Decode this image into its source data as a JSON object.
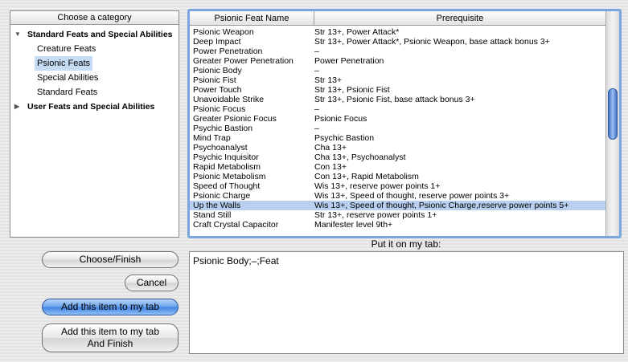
{
  "category_pane": {
    "header": "Choose a category",
    "items": [
      {
        "label": "Standard Feats and Special Abilities",
        "group": true,
        "expanded": true,
        "triangle": "▼"
      },
      {
        "label": "Creature Feats",
        "group": false
      },
      {
        "label": "Psionic Feats",
        "group": false,
        "selected": true
      },
      {
        "label": "Special Abilities",
        "group": false
      },
      {
        "label": "Standard Feats",
        "group": false
      },
      {
        "label": "User Feats and Special Abilities",
        "group": true,
        "expanded": false,
        "triangle": "▶"
      }
    ]
  },
  "feat_table": {
    "columns": [
      "Psionic Feat Name",
      "Prerequisite"
    ],
    "rows": [
      [
        "Psionic Weapon",
        "Str 13+, Power Attack*"
      ],
      [
        "Deep Impact",
        "Str 13+, Power Attack*, Psionic Weapon, base attack bonus 3+"
      ],
      [
        "Power Penetration",
        "–"
      ],
      [
        "Greater Power Penetration",
        "Power Penetration"
      ],
      [
        "Psionic Body",
        "–"
      ],
      [
        "Psionic Fist",
        "Str 13+"
      ],
      [
        "Power Touch",
        "Str 13+, Psionic Fist"
      ],
      [
        "Unavoidable Strike",
        "Str 13+, Psionic Fist, base attack bonus 3+"
      ],
      [
        "Psionic Focus",
        "–"
      ],
      [
        "Greater Psionic Focus",
        "Psionic Focus"
      ],
      [
        "Psychic Bastion",
        "–"
      ],
      [
        "Mind Trap",
        "Psychic Bastion"
      ],
      [
        "Psychoanalyst",
        "Cha 13+"
      ],
      [
        "Psychic Inquisitor",
        "Cha 13+, Psychoanalyst"
      ],
      [
        "Rapid Metabolism",
        "Con 13+"
      ],
      [
        "Psionic Metabolism",
        "Con 13+, Rapid Metabolism"
      ],
      [
        "Speed of Thought",
        "Wis 13+, reserve power points 1+"
      ],
      [
        "Psionic Charge",
        "Wis 13+, Speed of thought, reserve power points 3+"
      ],
      [
        "Up the Walls",
        "Wis 13+, Speed of thought, Psionic Charge,reserve power points 5+"
      ],
      [
        "Stand Still",
        "Str 13+, reserve power points 1+"
      ],
      [
        "Craft Crystal Capacitor",
        "Manifester level 9th+"
      ]
    ],
    "selected_row": 18
  },
  "buttons": {
    "choose_finish": "Choose/Finish",
    "cancel": "Cancel",
    "add_item": "Add this item to my tab",
    "add_item_finish": "Add this item to my tab\nAnd Finish"
  },
  "tab_output": {
    "label": "Put it on my tab:",
    "value": "Psionic Body;–;Feat"
  },
  "colors": {
    "selection": "#b8cff0",
    "focus_ring": "#7aa6de",
    "blue_button": "#4f8ee6"
  }
}
